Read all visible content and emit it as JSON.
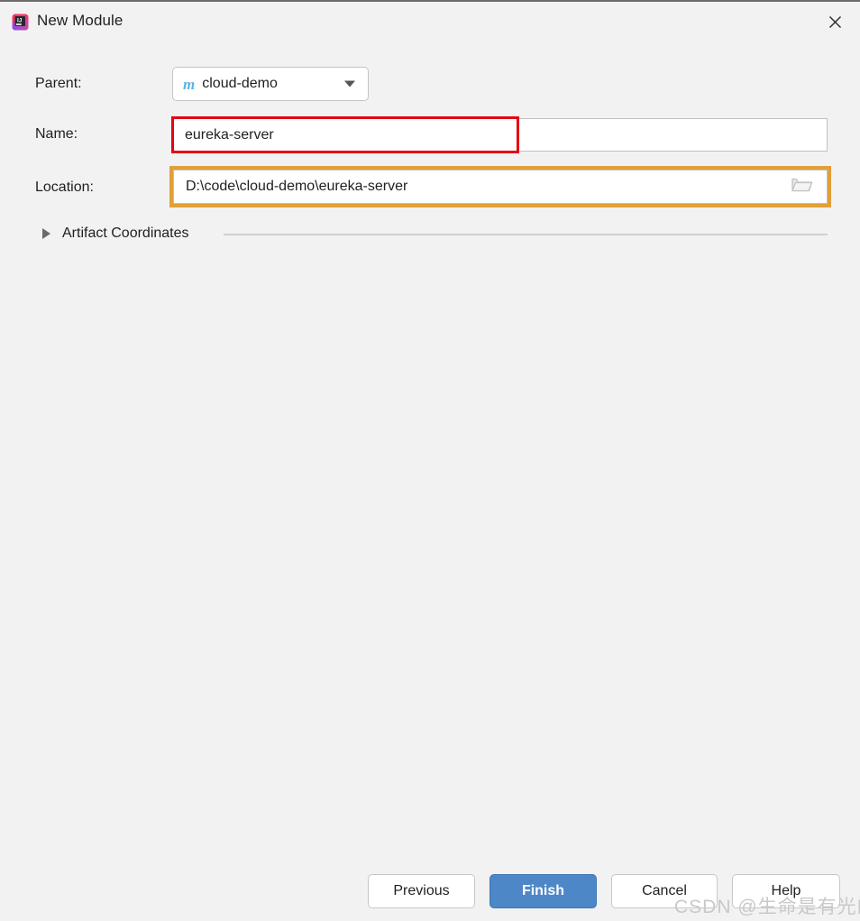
{
  "window": {
    "title": "New Module",
    "app_icon": "intellij-idea-icon",
    "close_icon": "close-icon"
  },
  "form": {
    "parent": {
      "label": "Parent:",
      "icon": "maven-module-icon",
      "icon_glyph": "m",
      "value": "cloud-demo",
      "chevron_icon": "chevron-down-icon"
    },
    "name": {
      "label": "Name:",
      "value": "eureka-server",
      "placeholder": ""
    },
    "location": {
      "label": "Location:",
      "value": "D:\\code\\cloud-demo\\eureka-server",
      "placeholder": "",
      "browse_icon": "folder-icon"
    },
    "artifact_coordinates": {
      "label": "Artifact Coordinates",
      "expanded": false,
      "toggle_icon": "triangle-right-icon"
    }
  },
  "buttons": {
    "previous": "Previous",
    "finish": "Finish",
    "cancel": "Cancel",
    "help": "Help"
  },
  "annotations": {
    "name_highlight_color": "#e60012",
    "location_highlight_color": "#e0a03a"
  },
  "watermark": {
    "text": "CSDN @生命是有光的"
  },
  "colors": {
    "background": "#f2f2f2",
    "accent_button": "#4d87c7",
    "maven_icon": "#5ab4e4",
    "field_border": "#c0c0c0"
  }
}
